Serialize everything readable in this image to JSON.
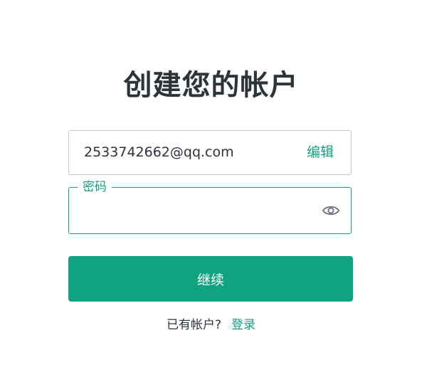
{
  "header": {
    "title": "创建您的帐户"
  },
  "form": {
    "email": {
      "value": "2533742662@qq.com",
      "edit_label": "编辑"
    },
    "password": {
      "label": "密码",
      "value": "",
      "toggle_icon": "eye-icon"
    },
    "continue_label": "继续"
  },
  "footer": {
    "prompt": "已有帐户?",
    "login_label": "登录"
  },
  "colors": {
    "accent": "#10a37f",
    "text": "#2d333a",
    "border": "#c2c8d0"
  }
}
